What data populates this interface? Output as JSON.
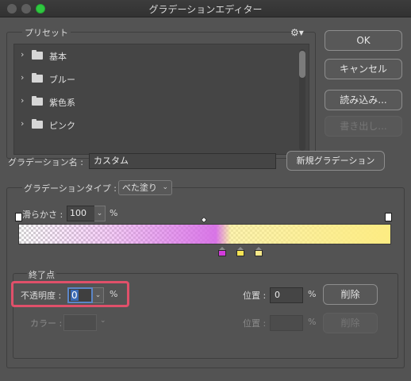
{
  "window": {
    "title": "グラデーションエディター"
  },
  "presets": {
    "heading": "プリセット",
    "items": [
      {
        "label": "基本"
      },
      {
        "label": "ブルー"
      },
      {
        "label": "紫色系"
      },
      {
        "label": "ピンク"
      }
    ]
  },
  "buttons": {
    "ok": "OK",
    "cancel": "キャンセル",
    "load": "読み込み...",
    "export": "書き出し...",
    "new_gradient": "新規グラデーション",
    "delete_opacity": "削除",
    "delete_color": "削除"
  },
  "gradient_name": {
    "label": "グラデーション名 :",
    "value": "カスタム"
  },
  "gradient_type": {
    "label": "グラデーションタイプ :",
    "value": "べた塗り"
  },
  "smoothness": {
    "label": "滑らかさ :",
    "value": "100",
    "unit": "%"
  },
  "stops": {
    "heading": "終了点",
    "opacity_label": "不透明度 :",
    "opacity_value": "0",
    "opacity_unit": "%",
    "opacity_location_label": "位置 :",
    "opacity_location_value": "0",
    "opacity_location_unit": "%",
    "color_label": "カラー :",
    "color_location_label": "位置 :",
    "color_location_value": "",
    "color_location_unit": "%"
  },
  "colors": {
    "opacity_stop_left": "#ffffff",
    "opacity_stop_right": "#ffffff",
    "color_stop_1": "#d23bdb",
    "color_stop_2": "#f7e455",
    "color_stop_3": "#f8e98a",
    "highlight": "#e0506a"
  }
}
